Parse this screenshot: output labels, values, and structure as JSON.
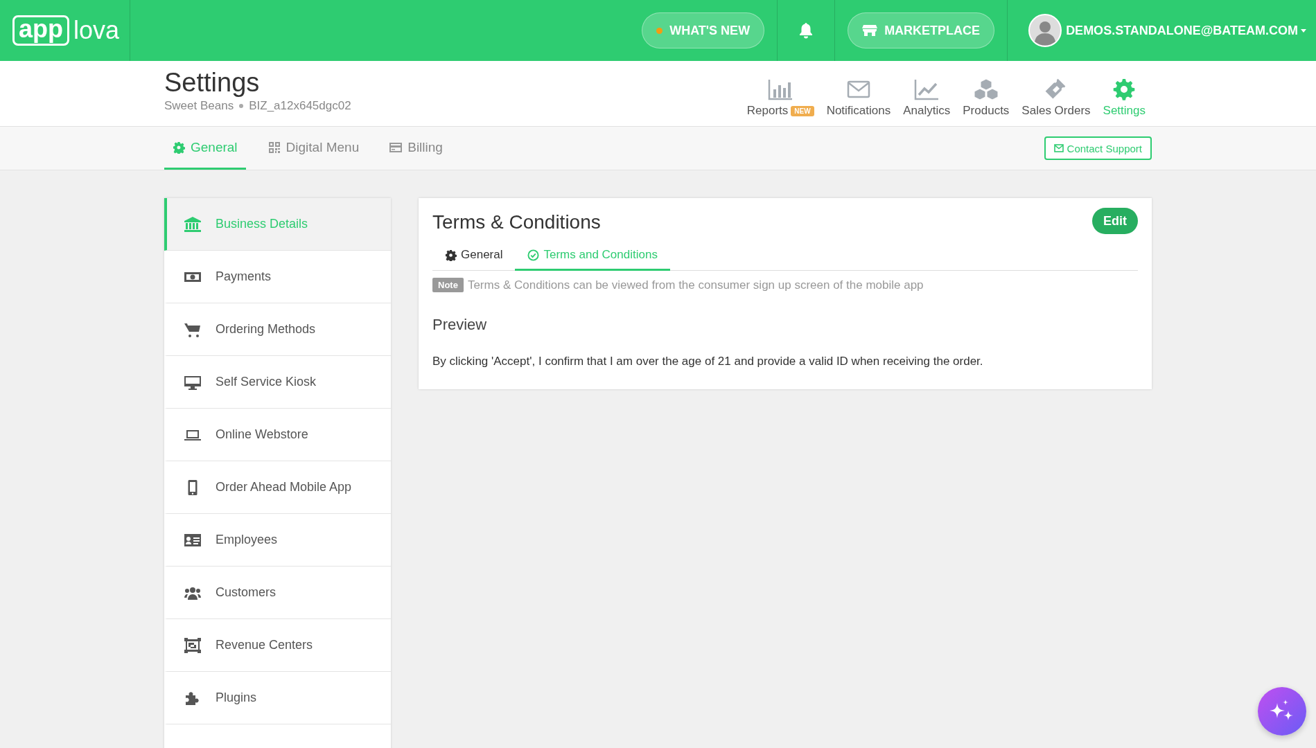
{
  "header": {
    "logo": {
      "left": "app",
      "right": "lova"
    },
    "whats_new": "WHAT'S NEW",
    "marketplace": "MARKETPLACE",
    "user": "DEMOS.STANDALONE@BATEAM.COM"
  },
  "page": {
    "title": "Settings",
    "business": "Sweet Beans",
    "business_id": "BIZ_a12x645dgc02"
  },
  "nav": [
    {
      "label": "Reports",
      "badge": "NEW",
      "kind": "chart",
      "selected": false
    },
    {
      "label": "Notifications",
      "kind": "mail",
      "selected": false
    },
    {
      "label": "Analytics",
      "kind": "trend",
      "selected": false
    },
    {
      "label": "Products",
      "kind": "boxes",
      "selected": false
    },
    {
      "label": "Sales Orders",
      "kind": "ticket",
      "selected": false
    },
    {
      "label": "Settings",
      "kind": "gear",
      "selected": true
    }
  ],
  "tabs": [
    {
      "label": "General",
      "kind": "gear",
      "selected": true
    },
    {
      "label": "Digital Menu",
      "kind": "qr",
      "selected": false
    },
    {
      "label": "Billing",
      "kind": "card",
      "selected": false
    }
  ],
  "contact_support": "Contact Support",
  "sidebar": {
    "items": [
      {
        "label": "Business Details",
        "kind": "bank",
        "selected": true
      },
      {
        "label": "Payments",
        "kind": "money",
        "selected": false
      },
      {
        "label": "Ordering Methods",
        "kind": "cart",
        "selected": false
      },
      {
        "label": "Self Service Kiosk",
        "kind": "monitor",
        "selected": false
      },
      {
        "label": "Online Webstore",
        "kind": "laptop",
        "selected": false
      },
      {
        "label": "Order Ahead Mobile App",
        "kind": "phone",
        "selected": false
      },
      {
        "label": "Employees",
        "kind": "idcard",
        "selected": false
      },
      {
        "label": "Customers",
        "kind": "users",
        "selected": false
      },
      {
        "label": "Revenue Centers",
        "kind": "frame",
        "selected": false
      },
      {
        "label": "Plugins",
        "kind": "puzzle",
        "selected": false
      }
    ]
  },
  "panel": {
    "title": "Terms & Conditions",
    "edit": "Edit",
    "tabs": [
      {
        "label": "General",
        "kind": "gear",
        "selected": false
      },
      {
        "label": "Terms and Conditions",
        "kind": "check",
        "selected": true
      }
    ],
    "note": {
      "tag": "Note",
      "text": "Terms & Conditions can be viewed from the consumer sign up screen of the mobile app"
    },
    "preview_heading": "Preview",
    "preview_text": "By clicking 'Accept', I confirm that I am over the age of 21 and provide a valid ID when receiving the order."
  }
}
